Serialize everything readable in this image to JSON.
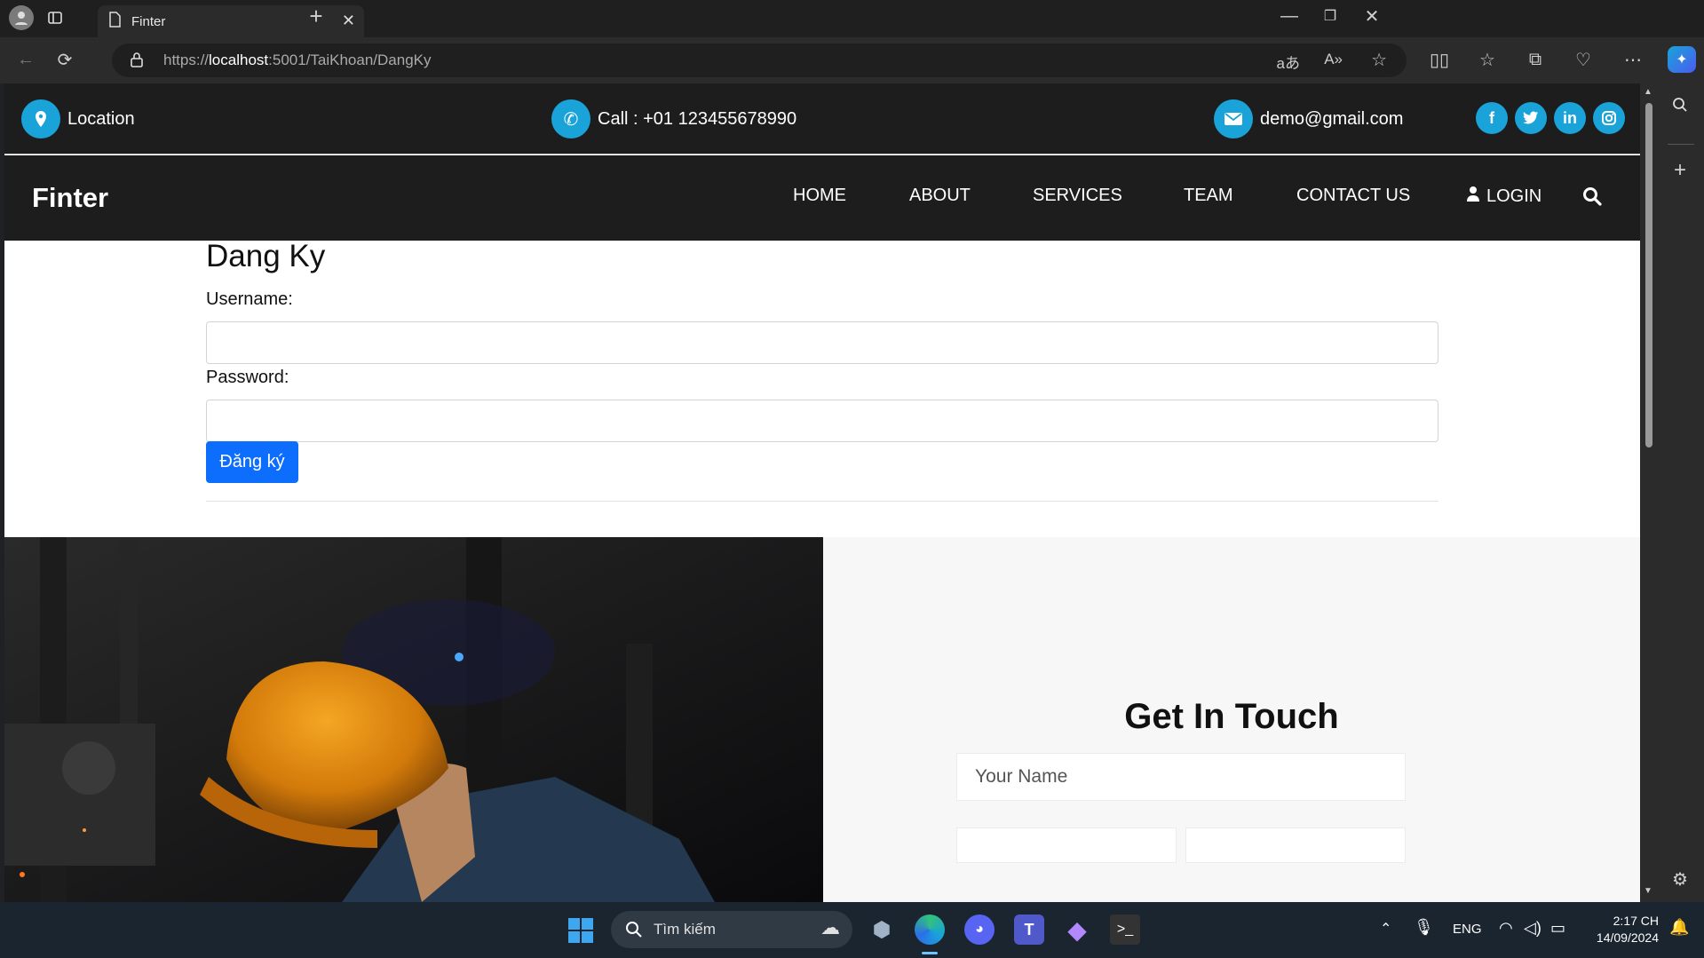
{
  "browser": {
    "tab_title": "Finter",
    "url_scheme": "https://",
    "url_host": "localhost",
    "url_rest": ":5001/TaiKhoan/DangKy"
  },
  "topbar": {
    "location": "Location",
    "phone": "Call : +01 123455678990",
    "email": "demo@gmail.com",
    "social": [
      "f",
      "t",
      "in",
      "ig"
    ]
  },
  "navbar": {
    "brand": "Finter",
    "items": [
      "HOME",
      "ABOUT",
      "SERVICES",
      "TEAM",
      "CONTACT US"
    ],
    "login": "LOGIN"
  },
  "form": {
    "heading": "Dang Ky",
    "username_label": "Username:",
    "username_value": "",
    "password_label": "Password:",
    "password_value": "",
    "submit": "Đăng ký"
  },
  "contact": {
    "heading": "Get In Touch",
    "name_placeholder": "Your Name"
  },
  "taskbar": {
    "search_placeholder": "Tìm kiếm",
    "language": "ENG",
    "time": "2:17 CH",
    "date": "14/09/2024"
  },
  "colors": {
    "accent": "#1aa3d8",
    "button": "#0d6efd",
    "dark": "#1d1d1d"
  }
}
